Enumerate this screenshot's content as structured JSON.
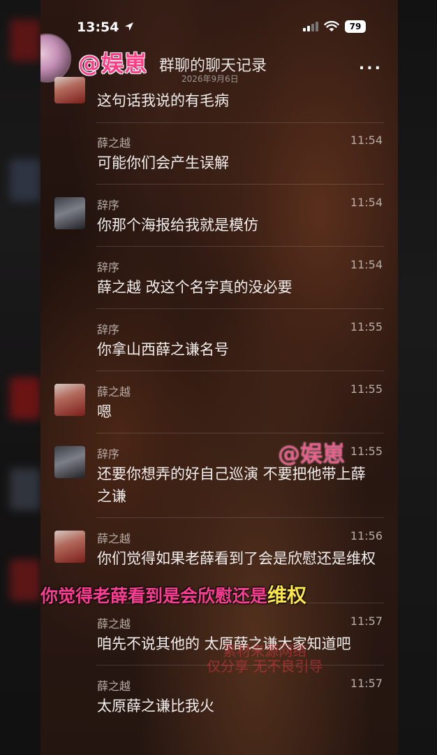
{
  "status_bar": {
    "time": "13:54",
    "battery": "79"
  },
  "header": {
    "watermark": "@娱崽",
    "title": "群聊的聊天记录",
    "subtitle": "2026年9月6日",
    "more": "..."
  },
  "messages": [
    {
      "name": "",
      "time": "",
      "text": "这句话我说的有毛病",
      "avatar": "a"
    },
    {
      "name": "薛之越",
      "time": "11:54",
      "text": "可能你们会产生误解",
      "avatar": ""
    },
    {
      "name": "辞序",
      "time": "11:54",
      "text": "你那个海报给我就是模仿",
      "avatar": "b"
    },
    {
      "name": "辞序",
      "time": "11:54",
      "text": "薛之越 改这个名字真的没必要",
      "avatar": ""
    },
    {
      "name": "辞序",
      "time": "11:55",
      "text": "你拿山西薛之谦名号",
      "avatar": ""
    },
    {
      "name": "薛之越",
      "time": "11:55",
      "text": "嗯",
      "avatar": "a"
    },
    {
      "name": "辞序",
      "time": "11:55",
      "text": "还要你想弄的好自己巡演 不要把他带上薛之谦",
      "avatar": "b"
    },
    {
      "name": "薛之越",
      "time": "11:56",
      "text": "你们觉得如果老薛看到了会是欣慰还是维权",
      "avatar": "a"
    },
    {
      "name": "薛之越",
      "time": "11:57",
      "text": "咱先不说其他的 太原薛之谦大家知道吧",
      "avatar": ""
    },
    {
      "name": "薛之越",
      "time": "11:57",
      "text": "太原薛之谦比我火",
      "avatar": ""
    }
  ],
  "overlay": {
    "watermark_mid": "@娱崽",
    "caption_pink": "你觉得老薛看到是会欣慰还是",
    "caption_yellow": "维权",
    "note_line1": "素材来源网络",
    "note_line2": "仅分享 无不良引导"
  }
}
